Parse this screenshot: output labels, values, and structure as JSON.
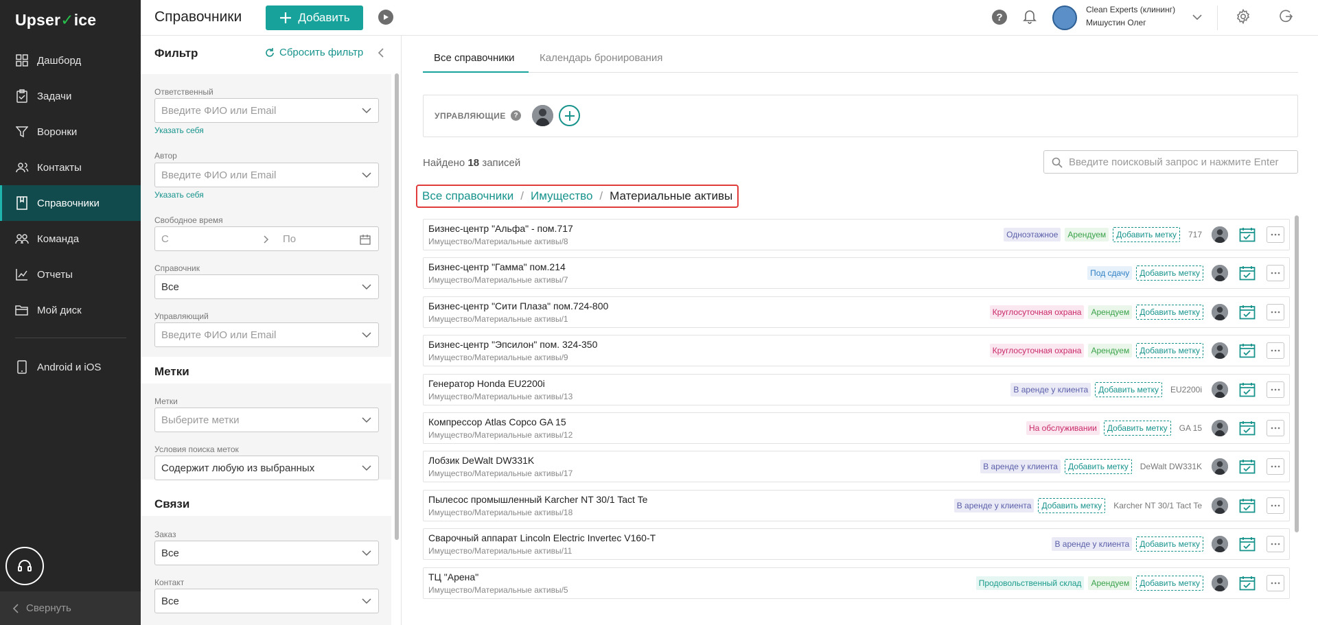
{
  "app": {
    "logo_left": "Upser",
    "logo_check": "✓",
    "logo_right": "ice"
  },
  "nav": {
    "items": [
      {
        "label": "Дашборд",
        "icon": "dashboard-icon"
      },
      {
        "label": "Задачи",
        "icon": "tasks-icon"
      },
      {
        "label": "Воронки",
        "icon": "funnel-icon"
      },
      {
        "label": "Контакты",
        "icon": "contacts-icon"
      },
      {
        "label": "Справочники",
        "icon": "book-icon",
        "active": true
      },
      {
        "label": "Команда",
        "icon": "team-icon"
      },
      {
        "label": "Отчеты",
        "icon": "reports-icon"
      },
      {
        "label": "Мой диск",
        "icon": "folder-icon"
      }
    ],
    "mobile": "Android и iOS",
    "collapse": "Свернуть"
  },
  "header": {
    "title": "Справочники",
    "add_label": "Добавить",
    "org_name": "Clean Experts (клининг)",
    "user_name": "Мишустин Олег",
    "help": "?"
  },
  "filter": {
    "title": "Фильтр",
    "reset": "Сбросить фильтр",
    "responsible_label": "Ответственный",
    "responsible_placeholder": "Введите ФИО или Email",
    "responsible_self": "Указать себя",
    "author_label": "Автор",
    "author_placeholder": "Введите ФИО или Email",
    "author_self": "Указать себя",
    "free_time_label": "Свободное время",
    "from": "С",
    "to": "По",
    "directory_label": "Справочник",
    "directory_value": "Все",
    "manager_label": "Управляющий",
    "manager_placeholder": "Введите ФИО или Email",
    "tags_section": "Метки",
    "tags_label": "Метки",
    "tags_placeholder": "Выберите метки",
    "tags_cond_label": "Условия поиска меток",
    "tags_cond_value": "Содержит любую из выбранных",
    "links_section": "Связи",
    "order_label": "Заказ",
    "order_value": "Все",
    "contact_label": "Контакт",
    "contact_value": "Все"
  },
  "main": {
    "tabs": [
      "Все справочники",
      "Календарь бронирования"
    ],
    "managers_label": "УПРАВЛЯЮЩИЕ",
    "found_prefix": "Найдено",
    "found_count": "18",
    "found_suffix": "записей",
    "search_placeholder": "Введите поисковый запрос и нажмите Enter",
    "breadcrumb": [
      "Все справочники",
      "Имущество",
      "Материальные активы"
    ],
    "add_tag": "Добавить метку",
    "rows": [
      {
        "title": "Бизнес-центр \"Альфа\" - пом.717",
        "path": "Имущество/Материальные активы/8",
        "tags": [
          {
            "t": "Одноэтажное",
            "c": "lav"
          },
          {
            "t": "Арендуем",
            "c": "grn"
          }
        ],
        "code": "717"
      },
      {
        "title": "Бизнес-центр \"Гамма\" пом.214",
        "path": "Имущество/Материальные активы/7",
        "tags": [
          {
            "t": "Под сдачу",
            "c": "blu"
          }
        ],
        "code": ""
      },
      {
        "title": "Бизнес-центр \"Сити Плаза\" пом.724-800",
        "path": "Имущество/Материальные активы/1",
        "tags": [
          {
            "t": "Круглосуточная охрана",
            "c": "pnk"
          },
          {
            "t": "Арендуем",
            "c": "grn"
          }
        ],
        "code": ""
      },
      {
        "title": "Бизнес-центр \"Эпсилон\" пом. 324-350",
        "path": "Имущество/Материальные активы/9",
        "tags": [
          {
            "t": "Круглосуточная охрана",
            "c": "pnk"
          },
          {
            "t": "Арендуем",
            "c": "grn"
          }
        ],
        "code": ""
      },
      {
        "title": "Генератор Honda EU2200i",
        "path": "Имущество/Материальные активы/13",
        "tags": [
          {
            "t": "В аренде у клиента",
            "c": "lav"
          }
        ],
        "code": "EU2200i"
      },
      {
        "title": "Компрессор Atlas Copco GA 15",
        "path": "Имущество/Материальные активы/12",
        "tags": [
          {
            "t": "На обслуживании",
            "c": "pnk"
          }
        ],
        "code": "GA 15"
      },
      {
        "title": "Лобзик DeWalt DW331K",
        "path": "Имущество/Материальные активы/17",
        "tags": [
          {
            "t": "В аренде у клиента",
            "c": "lav"
          }
        ],
        "code": "DeWalt DW331K"
      },
      {
        "title": "Пылесос промышленный Karcher NT 30/1 Tact Te",
        "path": "Имущество/Материальные активы/18",
        "tags": [
          {
            "t": "В аренде у клиента",
            "c": "lav"
          }
        ],
        "code": "Karcher NT 30/1 Tact Te"
      },
      {
        "title": "Сварочный аппарат Lincoln Electric Invertec V160-T",
        "path": "Имущество/Материальные активы/11",
        "tags": [
          {
            "t": "В аренде у клиента",
            "c": "lav"
          }
        ],
        "code": ""
      },
      {
        "title": "ТЦ \"Арена\"",
        "path": "Имущество/Материальные активы/5",
        "tags": [
          {
            "t": "Продовольственный склад",
            "c": "mint"
          },
          {
            "t": "Арендуем",
            "c": "grn"
          }
        ],
        "code": ""
      }
    ]
  },
  "colors": {
    "accent": "#17a39b",
    "sidebar": "#262626",
    "active_nav": "#124b4d",
    "highlight": "#e03a3a"
  }
}
